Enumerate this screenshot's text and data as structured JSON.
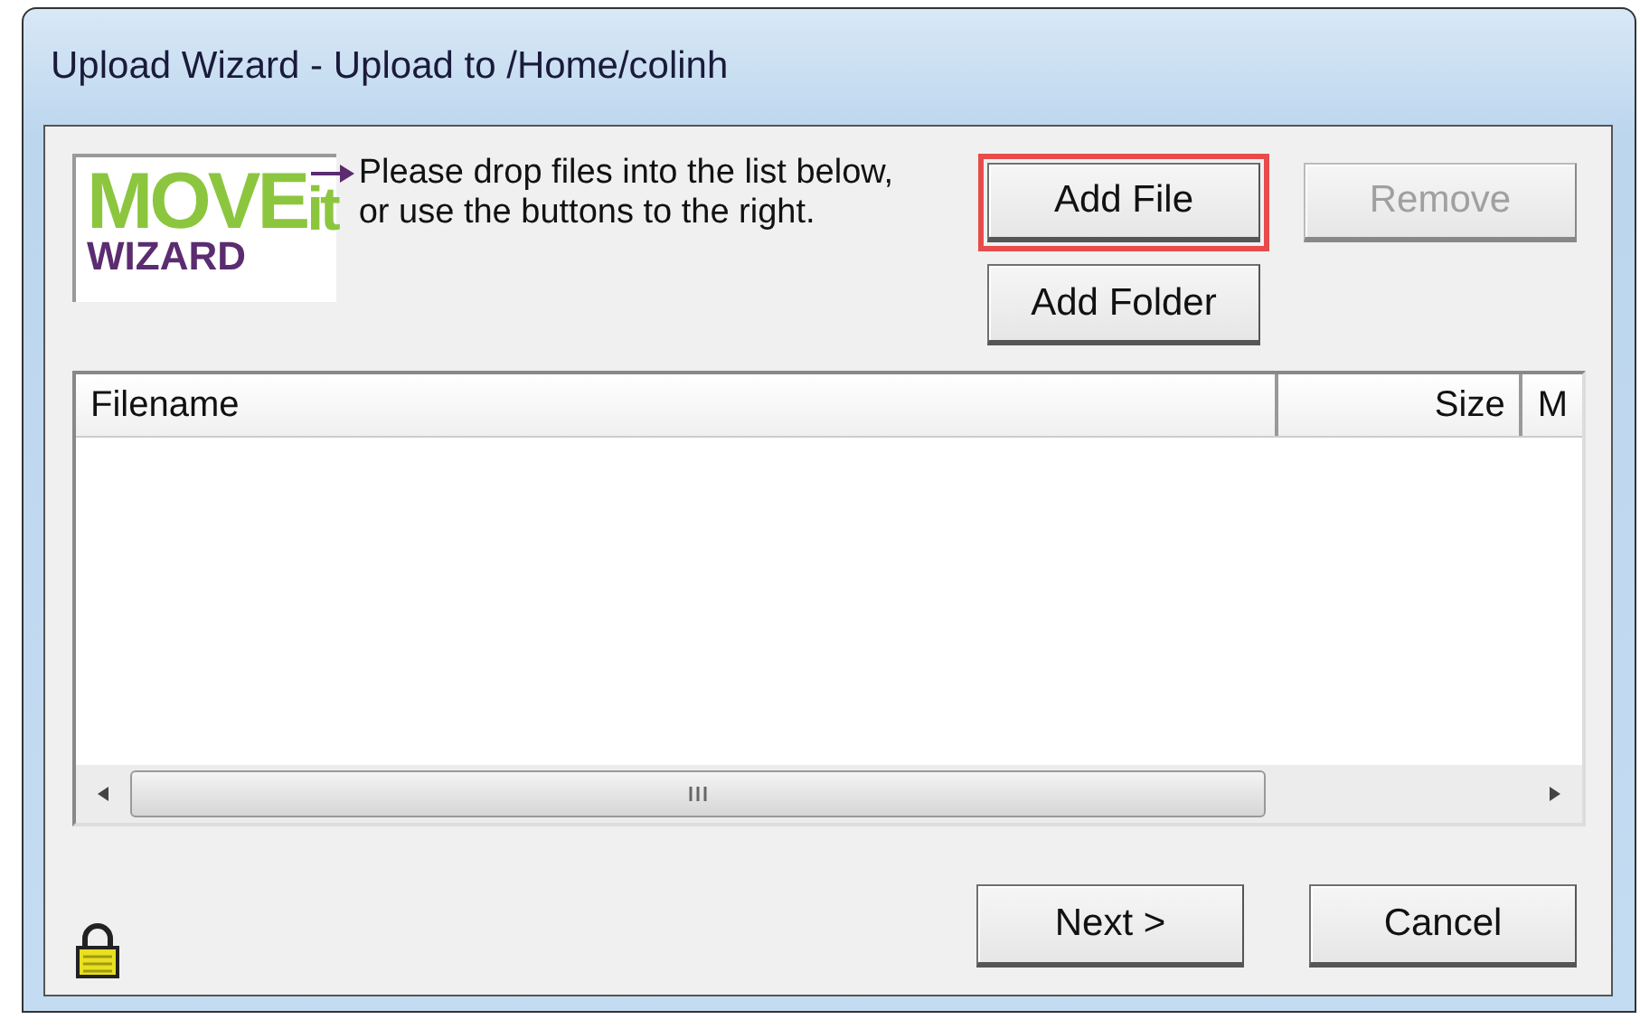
{
  "window": {
    "title": "Upload Wizard - Upload to /Home/colinh"
  },
  "logo": {
    "word": "MOVE",
    "suffix": "it",
    "subtitle": "WIZARD"
  },
  "instructions": "Please drop files into the list below,\nor use the buttons to the right.",
  "top_buttons": [
    {
      "label": "Add File",
      "disabled": false,
      "highlighted": true
    },
    {
      "label": "Remove",
      "disabled": true,
      "highlighted": false
    },
    {
      "label": "Add Folder",
      "disabled": false,
      "highlighted": false
    }
  ],
  "file_list": {
    "columns": [
      {
        "label": "Filename"
      },
      {
        "label": "Size"
      },
      {
        "label": "M"
      }
    ]
  },
  "footer_buttons": [
    {
      "label": "Next >",
      "disabled": false
    },
    {
      "label": "Cancel",
      "disabled": false
    }
  ]
}
